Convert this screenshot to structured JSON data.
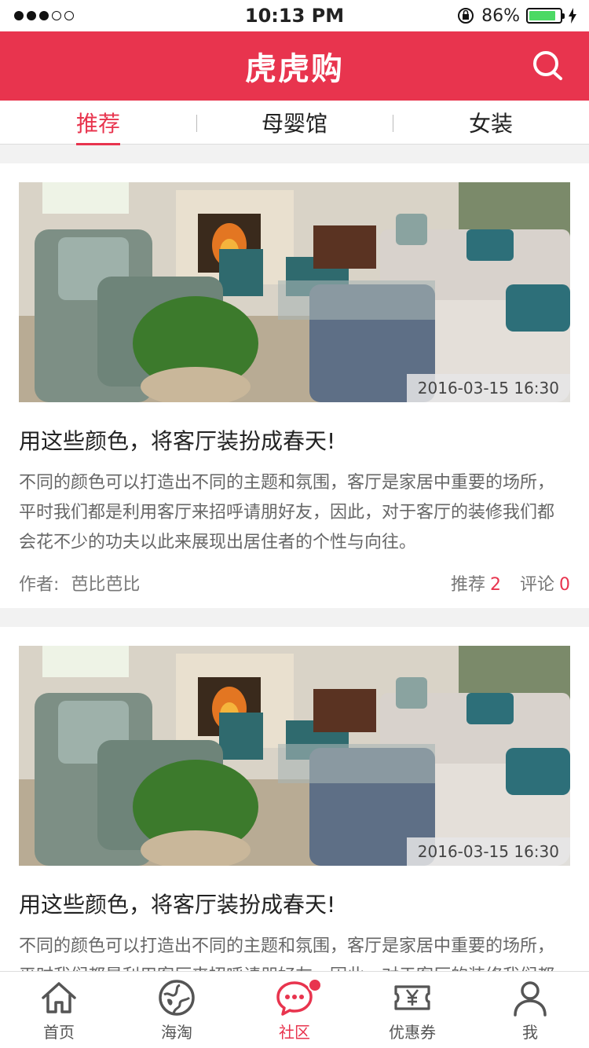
{
  "status_bar": {
    "time": "10:13 PM",
    "battery": "86%",
    "battery_level": 0.86
  },
  "header": {
    "title": "虎虎购"
  },
  "tabs": [
    {
      "label": "推荐",
      "active": true
    },
    {
      "label": "母婴馆",
      "active": false
    },
    {
      "label": "女装",
      "active": false
    }
  ],
  "posts": [
    {
      "date": "2016-03-15 16:30",
      "title": "用这些颜色，将客厅装扮成春天!",
      "body": "不同的颜色可以打造出不同的主题和氛围，客厅是家居中重要的场所，平时我们都是利用客厅来招呼请朋好友，因此，对于客厅的装修我们都会花不少的功夫以此来展现出居住者的个性与向往。",
      "author_label": "作者:",
      "author": "芭比芭比",
      "recommend_label": "推荐",
      "recommend_count": "2",
      "comment_label": "评论",
      "comment_count": "0"
    },
    {
      "date": "2016-03-15 16:30",
      "title": "用这些颜色，将客厅装扮成春天!",
      "body": "不同的颜色可以打造出不同的主题和氛围，客厅是家居中重要的场所，平时我们都是利用客厅来招呼请朋好友，因此，对于客厅的装修我们都会花不少的功夫以此来展现出居住者的个性与向往。"
    }
  ],
  "bottom_nav": [
    {
      "label": "首页",
      "icon": "home-icon"
    },
    {
      "label": "海淘",
      "icon": "globe-icon"
    },
    {
      "label": "社区",
      "icon": "chat-icon",
      "active": true
    },
    {
      "label": "优惠券",
      "icon": "coupon-icon"
    },
    {
      "label": "我",
      "icon": "user-icon"
    }
  ],
  "colors": {
    "brand": "#e8344e"
  }
}
